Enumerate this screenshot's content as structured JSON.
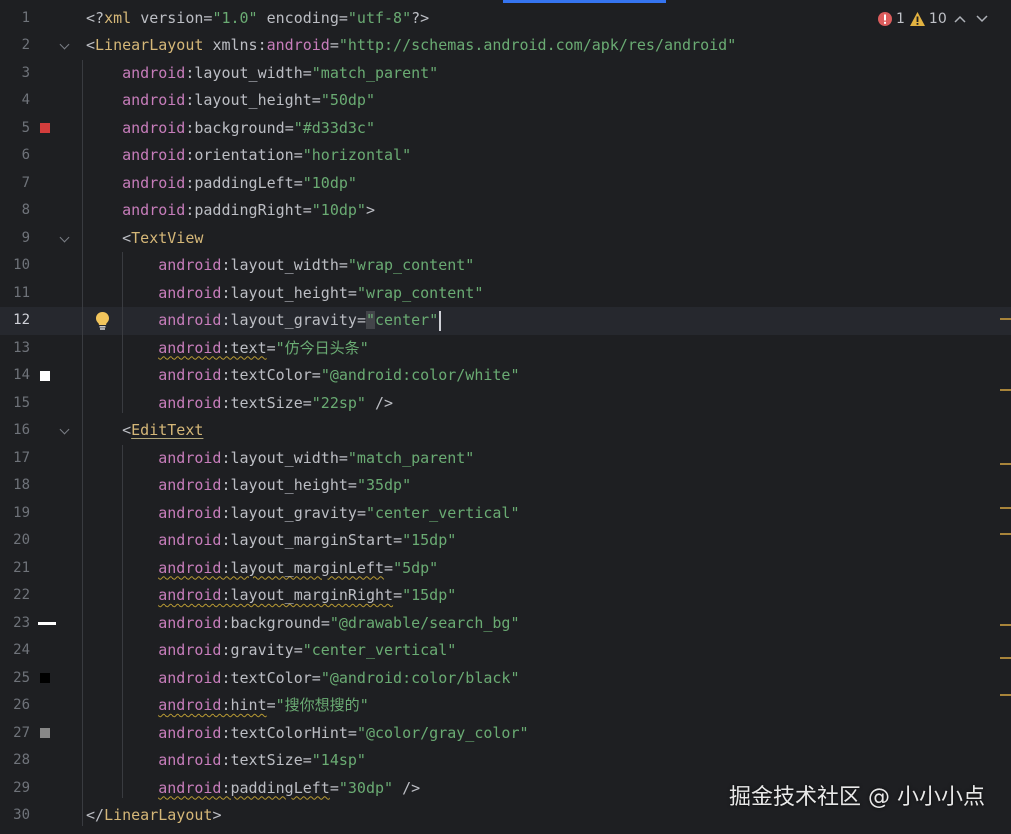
{
  "inspection": {
    "errors": "1",
    "warnings": "10"
  },
  "watermark": "掘金技术社区 @ 小小小点",
  "lines": [
    {
      "num": "1",
      "tokens": [
        [
          "punc",
          "<?"
        ],
        [
          "tag",
          "xml "
        ],
        [
          "attr",
          "version"
        ],
        [
          "op",
          "="
        ],
        [
          "val",
          "\"1.0\""
        ],
        [
          "attr",
          " encoding"
        ],
        [
          "op",
          "="
        ],
        [
          "val",
          "\"utf-8\""
        ],
        [
          "punc",
          "?>"
        ]
      ]
    },
    {
      "num": "2",
      "tokens": [
        [
          "punc",
          "<"
        ],
        [
          "tag",
          "LinearLayout "
        ],
        [
          "attr",
          "xmlns:"
        ],
        [
          "ns",
          "android"
        ],
        [
          "op",
          "="
        ],
        [
          "val",
          "\"http://schemas.android.com/apk/res/android\""
        ]
      ]
    },
    {
      "num": "3",
      "tokens": [
        [
          "pad",
          "    "
        ],
        [
          "ns",
          "android"
        ],
        [
          "attr",
          ":layout_width"
        ],
        [
          "op",
          "="
        ],
        [
          "val",
          "\"match_parent\""
        ]
      ]
    },
    {
      "num": "4",
      "tokens": [
        [
          "pad",
          "    "
        ],
        [
          "ns",
          "android"
        ],
        [
          "attr",
          ":layout_height"
        ],
        [
          "op",
          "="
        ],
        [
          "val",
          "\"50dp\""
        ]
      ]
    },
    {
      "num": "5",
      "tokens": [
        [
          "pad",
          "    "
        ],
        [
          "ns",
          "android"
        ],
        [
          "attr",
          ":background"
        ],
        [
          "op",
          "="
        ],
        [
          "val",
          "\"#d33d3c\""
        ]
      ]
    },
    {
      "num": "6",
      "tokens": [
        [
          "pad",
          "    "
        ],
        [
          "ns",
          "android"
        ],
        [
          "attr",
          ":orientation"
        ],
        [
          "op",
          "="
        ],
        [
          "val",
          "\"horizontal\""
        ]
      ]
    },
    {
      "num": "7",
      "tokens": [
        [
          "pad",
          "    "
        ],
        [
          "ns",
          "android"
        ],
        [
          "attr",
          ":paddingLeft"
        ],
        [
          "op",
          "="
        ],
        [
          "val",
          "\"10dp\""
        ]
      ]
    },
    {
      "num": "8",
      "tokens": [
        [
          "pad",
          "    "
        ],
        [
          "ns",
          "android"
        ],
        [
          "attr",
          ":paddingRight"
        ],
        [
          "op",
          "="
        ],
        [
          "val",
          "\"10dp\""
        ],
        [
          "punc",
          ">"
        ]
      ]
    },
    {
      "num": "9",
      "tokens": [
        [
          "pad",
          "    "
        ],
        [
          "punc",
          "<"
        ],
        [
          "tag",
          "TextView"
        ]
      ]
    },
    {
      "num": "10",
      "tokens": [
        [
          "pad",
          "        "
        ],
        [
          "ns",
          "android"
        ],
        [
          "attr",
          ":layout_width"
        ],
        [
          "op",
          "="
        ],
        [
          "val",
          "\"wrap_content\""
        ]
      ]
    },
    {
      "num": "11",
      "tokens": [
        [
          "pad",
          "        "
        ],
        [
          "ns",
          "android"
        ],
        [
          "attr",
          ":layout_height"
        ],
        [
          "op",
          "="
        ],
        [
          "val",
          "\"wrap_content\""
        ]
      ]
    },
    {
      "num": "12",
      "tokens": [
        [
          "pad",
          "        "
        ],
        [
          "ns",
          "android"
        ],
        [
          "attr",
          ":layout_gravity"
        ],
        [
          "op",
          "="
        ],
        [
          "valq",
          "\""
        ],
        [
          "val",
          "center"
        ],
        [
          "val",
          "\""
        ]
      ]
    },
    {
      "num": "13",
      "tokens": [
        [
          "pad",
          "        "
        ],
        [
          "nsw",
          "android"
        ],
        [
          "attrw",
          ":text"
        ],
        [
          "op",
          "="
        ],
        [
          "val",
          "\"仿今日头条\""
        ]
      ]
    },
    {
      "num": "14",
      "tokens": [
        [
          "pad",
          "        "
        ],
        [
          "ns",
          "android"
        ],
        [
          "attr",
          ":textColor"
        ],
        [
          "op",
          "="
        ],
        [
          "val",
          "\"@android:color/white\""
        ]
      ]
    },
    {
      "num": "15",
      "tokens": [
        [
          "pad",
          "        "
        ],
        [
          "ns",
          "android"
        ],
        [
          "attr",
          ":textSize"
        ],
        [
          "op",
          "="
        ],
        [
          "val",
          "\"22sp\""
        ],
        [
          "punc",
          " />"
        ]
      ]
    },
    {
      "num": "16",
      "tokens": [
        [
          "pad",
          "    "
        ],
        [
          "punc",
          "<"
        ],
        [
          "tagu",
          "EditText"
        ]
      ]
    },
    {
      "num": "17",
      "tokens": [
        [
          "pad",
          "        "
        ],
        [
          "ns",
          "android"
        ],
        [
          "attr",
          ":layout_width"
        ],
        [
          "op",
          "="
        ],
        [
          "val",
          "\"match_parent\""
        ]
      ]
    },
    {
      "num": "18",
      "tokens": [
        [
          "pad",
          "        "
        ],
        [
          "ns",
          "android"
        ],
        [
          "attr",
          ":layout_height"
        ],
        [
          "op",
          "="
        ],
        [
          "val",
          "\"35dp\""
        ]
      ]
    },
    {
      "num": "19",
      "tokens": [
        [
          "pad",
          "        "
        ],
        [
          "ns",
          "android"
        ],
        [
          "attr",
          ":layout_gravity"
        ],
        [
          "op",
          "="
        ],
        [
          "val",
          "\"center_vertical\""
        ]
      ]
    },
    {
      "num": "20",
      "tokens": [
        [
          "pad",
          "        "
        ],
        [
          "ns",
          "android"
        ],
        [
          "attr",
          ":layout_marginStart"
        ],
        [
          "op",
          "="
        ],
        [
          "val",
          "\"15dp\""
        ]
      ]
    },
    {
      "num": "21",
      "tokens": [
        [
          "pad",
          "        "
        ],
        [
          "nsw",
          "android"
        ],
        [
          "attrw",
          ":layout_marginLeft"
        ],
        [
          "op",
          "="
        ],
        [
          "val",
          "\"5dp\""
        ]
      ]
    },
    {
      "num": "22",
      "tokens": [
        [
          "pad",
          "        "
        ],
        [
          "nsw",
          "android"
        ],
        [
          "attrw",
          ":layout_marginRight"
        ],
        [
          "op",
          "="
        ],
        [
          "val",
          "\"15dp\""
        ]
      ]
    },
    {
      "num": "23",
      "tokens": [
        [
          "pad",
          "        "
        ],
        [
          "ns",
          "android"
        ],
        [
          "attr",
          ":background"
        ],
        [
          "op",
          "="
        ],
        [
          "val",
          "\"@drawable/search_bg\""
        ]
      ]
    },
    {
      "num": "24",
      "tokens": [
        [
          "pad",
          "        "
        ],
        [
          "ns",
          "android"
        ],
        [
          "attr",
          ":gravity"
        ],
        [
          "op",
          "="
        ],
        [
          "val",
          "\"center_vertical\""
        ]
      ]
    },
    {
      "num": "25",
      "tokens": [
        [
          "pad",
          "        "
        ],
        [
          "ns",
          "android"
        ],
        [
          "attr",
          ":textColor"
        ],
        [
          "op",
          "="
        ],
        [
          "val",
          "\"@android:color/black\""
        ]
      ]
    },
    {
      "num": "26",
      "tokens": [
        [
          "pad",
          "        "
        ],
        [
          "nsw",
          "android"
        ],
        [
          "attrw",
          ":hint"
        ],
        [
          "op",
          "="
        ],
        [
          "val",
          "\"搜你想搜的\""
        ]
      ]
    },
    {
      "num": "27",
      "tokens": [
        [
          "pad",
          "        "
        ],
        [
          "ns",
          "android"
        ],
        [
          "attr",
          ":textColorHint"
        ],
        [
          "op",
          "="
        ],
        [
          "val",
          "\"@color/gray_color\""
        ]
      ]
    },
    {
      "num": "28",
      "tokens": [
        [
          "pad",
          "        "
        ],
        [
          "ns",
          "android"
        ],
        [
          "attr",
          ":textSize"
        ],
        [
          "op",
          "="
        ],
        [
          "val",
          "\"14sp\""
        ]
      ]
    },
    {
      "num": "29",
      "tokens": [
        [
          "pad",
          "        "
        ],
        [
          "nsw",
          "android"
        ],
        [
          "attrw",
          ":paddingLeft"
        ],
        [
          "op",
          "="
        ],
        [
          "val",
          "\"30dp\""
        ],
        [
          "punc",
          " />"
        ]
      ]
    },
    {
      "num": "30",
      "tokens": [
        [
          "punc",
          "</"
        ],
        [
          "tag",
          "LinearLayout"
        ],
        [
          "punc",
          ">"
        ]
      ]
    }
  ],
  "current_line": 12,
  "fold_lines": [
    2,
    9,
    16
  ],
  "gutter_swatches": [
    {
      "line": 5,
      "color": "#d33d3c",
      "shape": "square"
    },
    {
      "line": 14,
      "color": "#ffffff",
      "shape": "square"
    },
    {
      "line": 23,
      "color": "#ffffff",
      "shape": "bar"
    },
    {
      "line": 25,
      "color": "#000000",
      "shape": "square"
    },
    {
      "line": 27,
      "color": "#888888",
      "shape": "square"
    }
  ],
  "bulb_line": 12,
  "scroll_marks": [
    318,
    389,
    463,
    507,
    533,
    624,
    657,
    694
  ]
}
